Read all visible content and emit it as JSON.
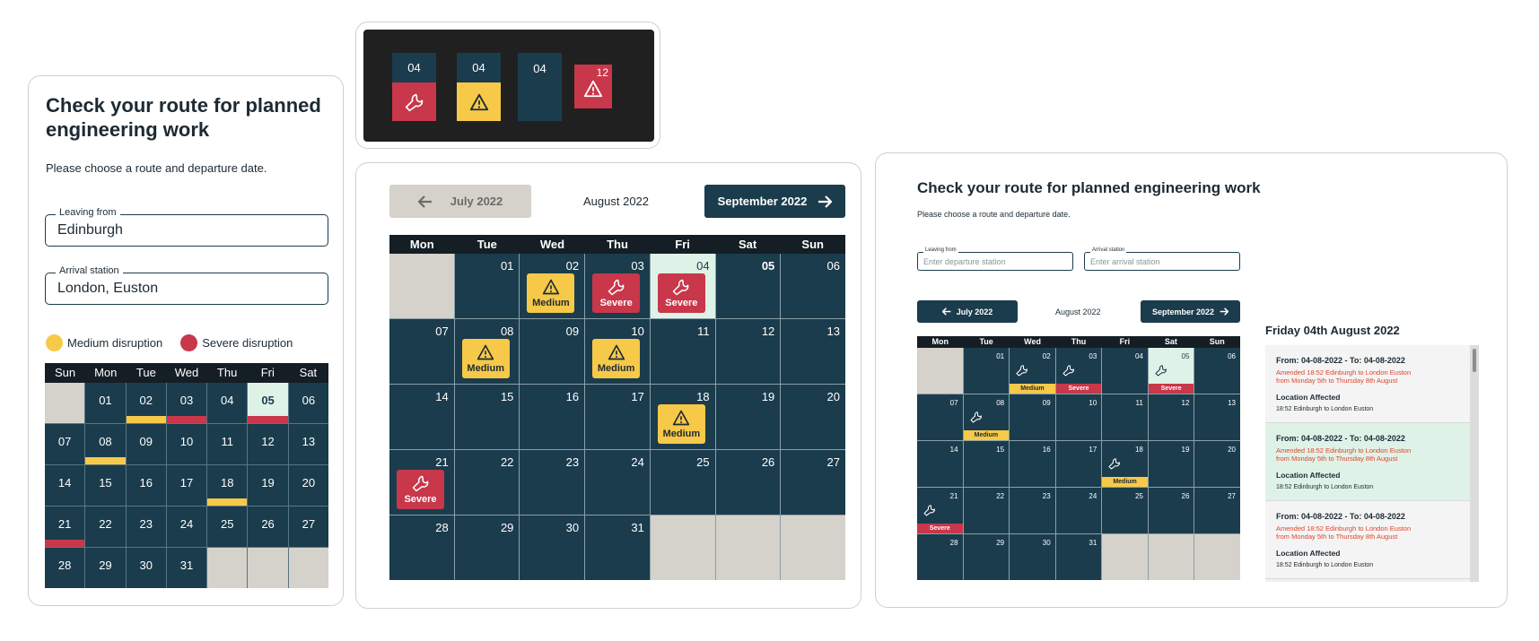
{
  "colors": {
    "navy": "#1b3c4c",
    "yellow": "#f7c948",
    "red": "#c8374a",
    "mint": "#dff2e7",
    "grey": "#d5d1cb"
  },
  "panel_a": {
    "title": "Check your route for planned engineering work",
    "subtitle": "Please choose a route and departure date.",
    "leaving_label": "Leaving from",
    "leaving_value": "Edinburgh",
    "arrival_label": "Arrival station",
    "arrival_value": "London, Euston",
    "legend_medium": "Medium disruption",
    "legend_severe": "Severe disruption",
    "weekdays": [
      "Sun",
      "Mon",
      "Tue",
      "Wed",
      "Thu",
      "Fri",
      "Sat"
    ],
    "cells": [
      {
        "d": "",
        "g": true
      },
      {
        "d": "01"
      },
      {
        "d": "02",
        "s": "medium"
      },
      {
        "d": "03",
        "s": "severe"
      },
      {
        "d": "04"
      },
      {
        "d": "05",
        "s": "severe",
        "t": true
      },
      {
        "d": "06"
      },
      {
        "d": "07"
      },
      {
        "d": "08",
        "s": "medium"
      },
      {
        "d": "09"
      },
      {
        "d": "10"
      },
      {
        "d": "11"
      },
      {
        "d": "12"
      },
      {
        "d": "13"
      },
      {
        "d": "14"
      },
      {
        "d": "15"
      },
      {
        "d": "16"
      },
      {
        "d": "17"
      },
      {
        "d": "18",
        "s": "medium"
      },
      {
        "d": "19"
      },
      {
        "d": "20"
      },
      {
        "d": "21",
        "s": "severe"
      },
      {
        "d": "22"
      },
      {
        "d": "23"
      },
      {
        "d": "24"
      },
      {
        "d": "25"
      },
      {
        "d": "26"
      },
      {
        "d": "27"
      },
      {
        "d": "28"
      },
      {
        "d": "29"
      },
      {
        "d": "30"
      },
      {
        "d": "31"
      },
      {
        "d": "",
        "g": true
      },
      {
        "d": "",
        "g": true
      },
      {
        "d": "",
        "g": true
      }
    ]
  },
  "panel_b": {
    "tiles": [
      {
        "date": "04",
        "icon": "wrench-icon",
        "status": "severe"
      },
      {
        "date": "04",
        "icon": "warning-icon",
        "status": "medium"
      },
      {
        "date": "04",
        "icon": "",
        "status": "none"
      },
      {
        "date": "12",
        "icon": "warning-icon",
        "status": "severe"
      }
    ]
  },
  "panel_c": {
    "prev_label": "July 2022",
    "month_label": "August 2022",
    "next_label": "September 2022",
    "weekdays": [
      "Mon",
      "Tue",
      "Wed",
      "Thu",
      "Fri",
      "Sat",
      "Sun"
    ],
    "cells": [
      {
        "d": "",
        "g": true
      },
      {
        "d": "01"
      },
      {
        "d": "02",
        "b": "medium",
        "bl": "Medium",
        "i": "warning"
      },
      {
        "d": "03",
        "b": "severe",
        "bl": "Severe",
        "i": "wrench"
      },
      {
        "d": "04",
        "b": "severe",
        "bl": "Severe",
        "i": "wrench",
        "t": true
      },
      {
        "d": "05",
        "bold": true
      },
      {
        "d": "06"
      },
      {
        "d": "07"
      },
      {
        "d": "08",
        "b": "medium",
        "bl": "Medium",
        "i": "warning"
      },
      {
        "d": "09"
      },
      {
        "d": "10",
        "b": "medium",
        "bl": "Medium",
        "i": "warning"
      },
      {
        "d": "11"
      },
      {
        "d": "12"
      },
      {
        "d": "13"
      },
      {
        "d": "14"
      },
      {
        "d": "15"
      },
      {
        "d": "16"
      },
      {
        "d": "17"
      },
      {
        "d": "18",
        "b": "medium",
        "bl": "Medium",
        "i": "warning"
      },
      {
        "d": "19"
      },
      {
        "d": "20"
      },
      {
        "d": "21",
        "b": "severe",
        "bl": "Severe",
        "i": "wrench"
      },
      {
        "d": "22"
      },
      {
        "d": "23"
      },
      {
        "d": "24"
      },
      {
        "d": "25"
      },
      {
        "d": "26"
      },
      {
        "d": "27"
      },
      {
        "d": "28"
      },
      {
        "d": "29"
      },
      {
        "d": "30"
      },
      {
        "d": "31"
      },
      {
        "d": "",
        "g": true
      },
      {
        "d": "",
        "g": true
      },
      {
        "d": "",
        "g": true
      }
    ]
  },
  "panel_d": {
    "title": "Check your route for planned engineering work",
    "subtitle": "Please choose a route and departure date.",
    "leaving_label": "Leaving from",
    "leaving_placeholder": "Enter departure station",
    "arrival_label": "Arrival station",
    "arrival_placeholder": "Enter arrival station",
    "prev_label": "July 2022",
    "month_label": "August 2022",
    "next_label": "September 2022",
    "weekdays": [
      "Mon",
      "Tue",
      "Wed",
      "Thu",
      "Fri",
      "Sat",
      "Sun"
    ],
    "cells": [
      {
        "d": "",
        "g": true
      },
      {
        "d": "01"
      },
      {
        "d": "02",
        "b": "medium",
        "bl": "Medium"
      },
      {
        "d": "03",
        "b": "severe",
        "bl": "Severe"
      },
      {
        "d": "04"
      },
      {
        "d": "05",
        "b": "severe",
        "bl": "Severe",
        "t": true
      },
      {
        "d": "06"
      },
      {
        "d": "07"
      },
      {
        "d": "08",
        "b": "medium",
        "bl": "Medium"
      },
      {
        "d": "09"
      },
      {
        "d": "10"
      },
      {
        "d": "11"
      },
      {
        "d": "12"
      },
      {
        "d": "13"
      },
      {
        "d": "14"
      },
      {
        "d": "15"
      },
      {
        "d": "16"
      },
      {
        "d": "17"
      },
      {
        "d": "18",
        "b": "medium",
        "bl": "Medium"
      },
      {
        "d": "19"
      },
      {
        "d": "20"
      },
      {
        "d": "21",
        "b": "severe",
        "bl": "Severe"
      },
      {
        "d": "22"
      },
      {
        "d": "23"
      },
      {
        "d": "24"
      },
      {
        "d": "25"
      },
      {
        "d": "26"
      },
      {
        "d": "27"
      },
      {
        "d": "28"
      },
      {
        "d": "29"
      },
      {
        "d": "30"
      },
      {
        "d": "31"
      },
      {
        "d": "",
        "g": true
      },
      {
        "d": "",
        "g": true
      },
      {
        "d": "",
        "g": true
      }
    ],
    "details_title": "Friday 04th August 2022",
    "details": [
      {
        "heading": "From: 04-08-2022 - To: 04-08-2022",
        "amend1": "Amended 18:52 Edinburgh to London Euston",
        "amend2": "from Monday 5th to Thursday 8th August",
        "loc_label": "Location Affected",
        "loc_value": "18:52 Edinburgh to London Euston",
        "selected": false
      },
      {
        "heading": "From: 04-08-2022 - To: 04-08-2022",
        "amend1": "Amended 18:52 Edinburgh to London Euston",
        "amend2": "from Monday 5th to Thursday 8th August",
        "loc_label": "Location Affected",
        "loc_value": "18:52 Edinburgh to London Euston",
        "selected": true
      },
      {
        "heading": "From: 04-08-2022 - To: 04-08-2022",
        "amend1": "Amended 18:52 Edinburgh to London Euston",
        "amend2": "from Monday 5th to Thursday 8th August",
        "loc_label": "Location Affected",
        "loc_value": "18:52 Edinburgh to London Euston",
        "selected": false
      }
    ]
  }
}
